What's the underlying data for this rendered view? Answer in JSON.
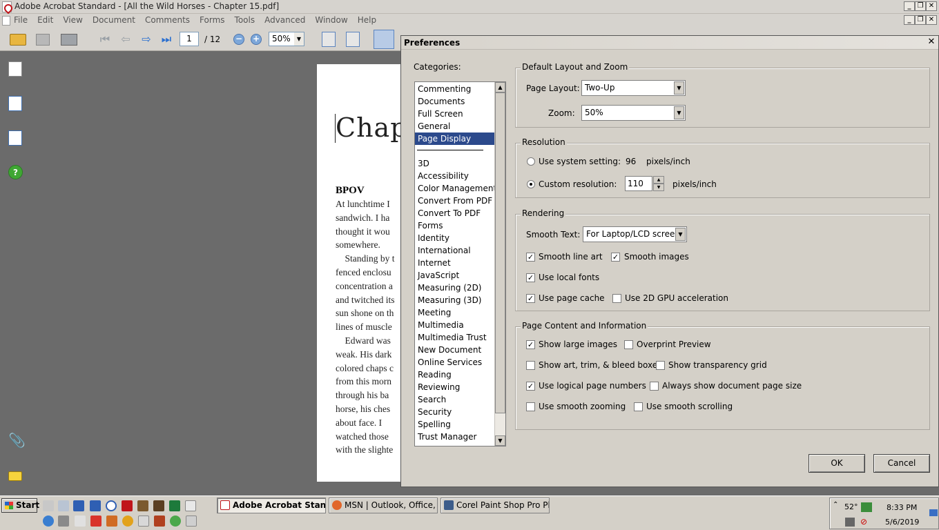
{
  "window": {
    "title": "Adobe Acrobat Standard - [All the Wild Horses - Chapter 15.pdf]",
    "controls": {
      "minimize": "_",
      "restore": "❐",
      "close": "✕"
    }
  },
  "menu": [
    "File",
    "Edit",
    "View",
    "Document",
    "Comments",
    "Forms",
    "Tools",
    "Advanced",
    "Window",
    "Help"
  ],
  "toolbar": {
    "page_current": "1",
    "page_total": "/ 12",
    "zoom": "50%"
  },
  "document": {
    "chapter_text": "Chapte",
    "heading": "BPOV",
    "lines": [
      "At lunchtime I",
      "sandwich.  I ha",
      "thought it wou",
      "somewhere.",
      "    Standing by t",
      "fenced enclosu",
      "concentration a",
      "and twitched its",
      "sun shone on th",
      "lines of muscle",
      "    Edward was",
      "weak.  His dark",
      "colored chaps c",
      "from this morn",
      "through his ba",
      "horse, his ches",
      "about face.  I",
      "watched those",
      "with the slighte"
    ]
  },
  "dialog": {
    "title": "Preferences",
    "close": "✕",
    "categories_label": "Categories:",
    "categories_top": [
      "Commenting",
      "Documents",
      "Full Screen",
      "General",
      "Page Display"
    ],
    "categories_rest": [
      "3D",
      "Accessibility",
      "Color Management",
      "Convert From PDF",
      "Convert To PDF",
      "Forms",
      "Identity",
      "International",
      "Internet",
      "JavaScript",
      "Measuring (2D)",
      "Measuring (3D)",
      "Meeting",
      "Multimedia",
      "Multimedia Trust",
      "New Document",
      "Online Services",
      "Reading",
      "Reviewing",
      "Search",
      "Security",
      "Spelling",
      "Trust Manager"
    ],
    "selected_category": "Page Display",
    "layout_zoom": {
      "title": "Default Layout and Zoom",
      "page_layout_label": "Page Layout:",
      "page_layout_value": "Two-Up",
      "zoom_label": "Zoom:",
      "zoom_value": "50%"
    },
    "resolution": {
      "title": "Resolution",
      "system_label": "Use system setting:",
      "system_value": "96",
      "system_unit": "pixels/inch",
      "custom_label": "Custom resolution:",
      "custom_value": "110",
      "custom_unit": "pixels/inch",
      "selected": "custom"
    },
    "rendering": {
      "title": "Rendering",
      "smooth_text_label": "Smooth Text:",
      "smooth_text_value": "For Laptop/LCD screens",
      "smooth_line_art": "Smooth line art",
      "smooth_images": "Smooth images",
      "use_local_fonts": "Use local fonts",
      "use_page_cache": "Use page cache",
      "use_2d_gpu": "Use 2D GPU acceleration",
      "checked": {
        "smooth_line_art": true,
        "smooth_images": true,
        "use_local_fonts": true,
        "use_page_cache": true,
        "use_2d_gpu": false
      }
    },
    "page_content": {
      "title": "Page Content and Information",
      "show_large_images": "Show large images",
      "overprint_preview": "Overprint Preview",
      "show_art_trim": "Show art, trim, & bleed boxes",
      "show_transparency_grid": "Show transparency grid",
      "use_logical_page_numbers": "Use logical page numbers",
      "always_show_doc_page_size": "Always show document page size",
      "use_smooth_zooming": "Use smooth zooming",
      "use_smooth_scrolling": "Use smooth scrolling",
      "checked": {
        "show_large_images": true,
        "overprint_preview": false,
        "show_art_trim": false,
        "show_transparency_grid": false,
        "use_logical_page_numbers": true,
        "always_show_doc_page_size": false,
        "use_smooth_zooming": false,
        "use_smooth_scrolling": false
      }
    },
    "ok_label": "OK",
    "cancel_label": "Cancel",
    "checkmark": "✓"
  },
  "taskbar": {
    "start_label": "Start",
    "items": [
      "Adobe Acrobat Stand...",
      "MSN | Outlook, Office, S...",
      "Corel Paint Shop Pro Pho..."
    ],
    "temperature": "52°",
    "time": "8:33 PM",
    "date": "5/6/2019"
  }
}
